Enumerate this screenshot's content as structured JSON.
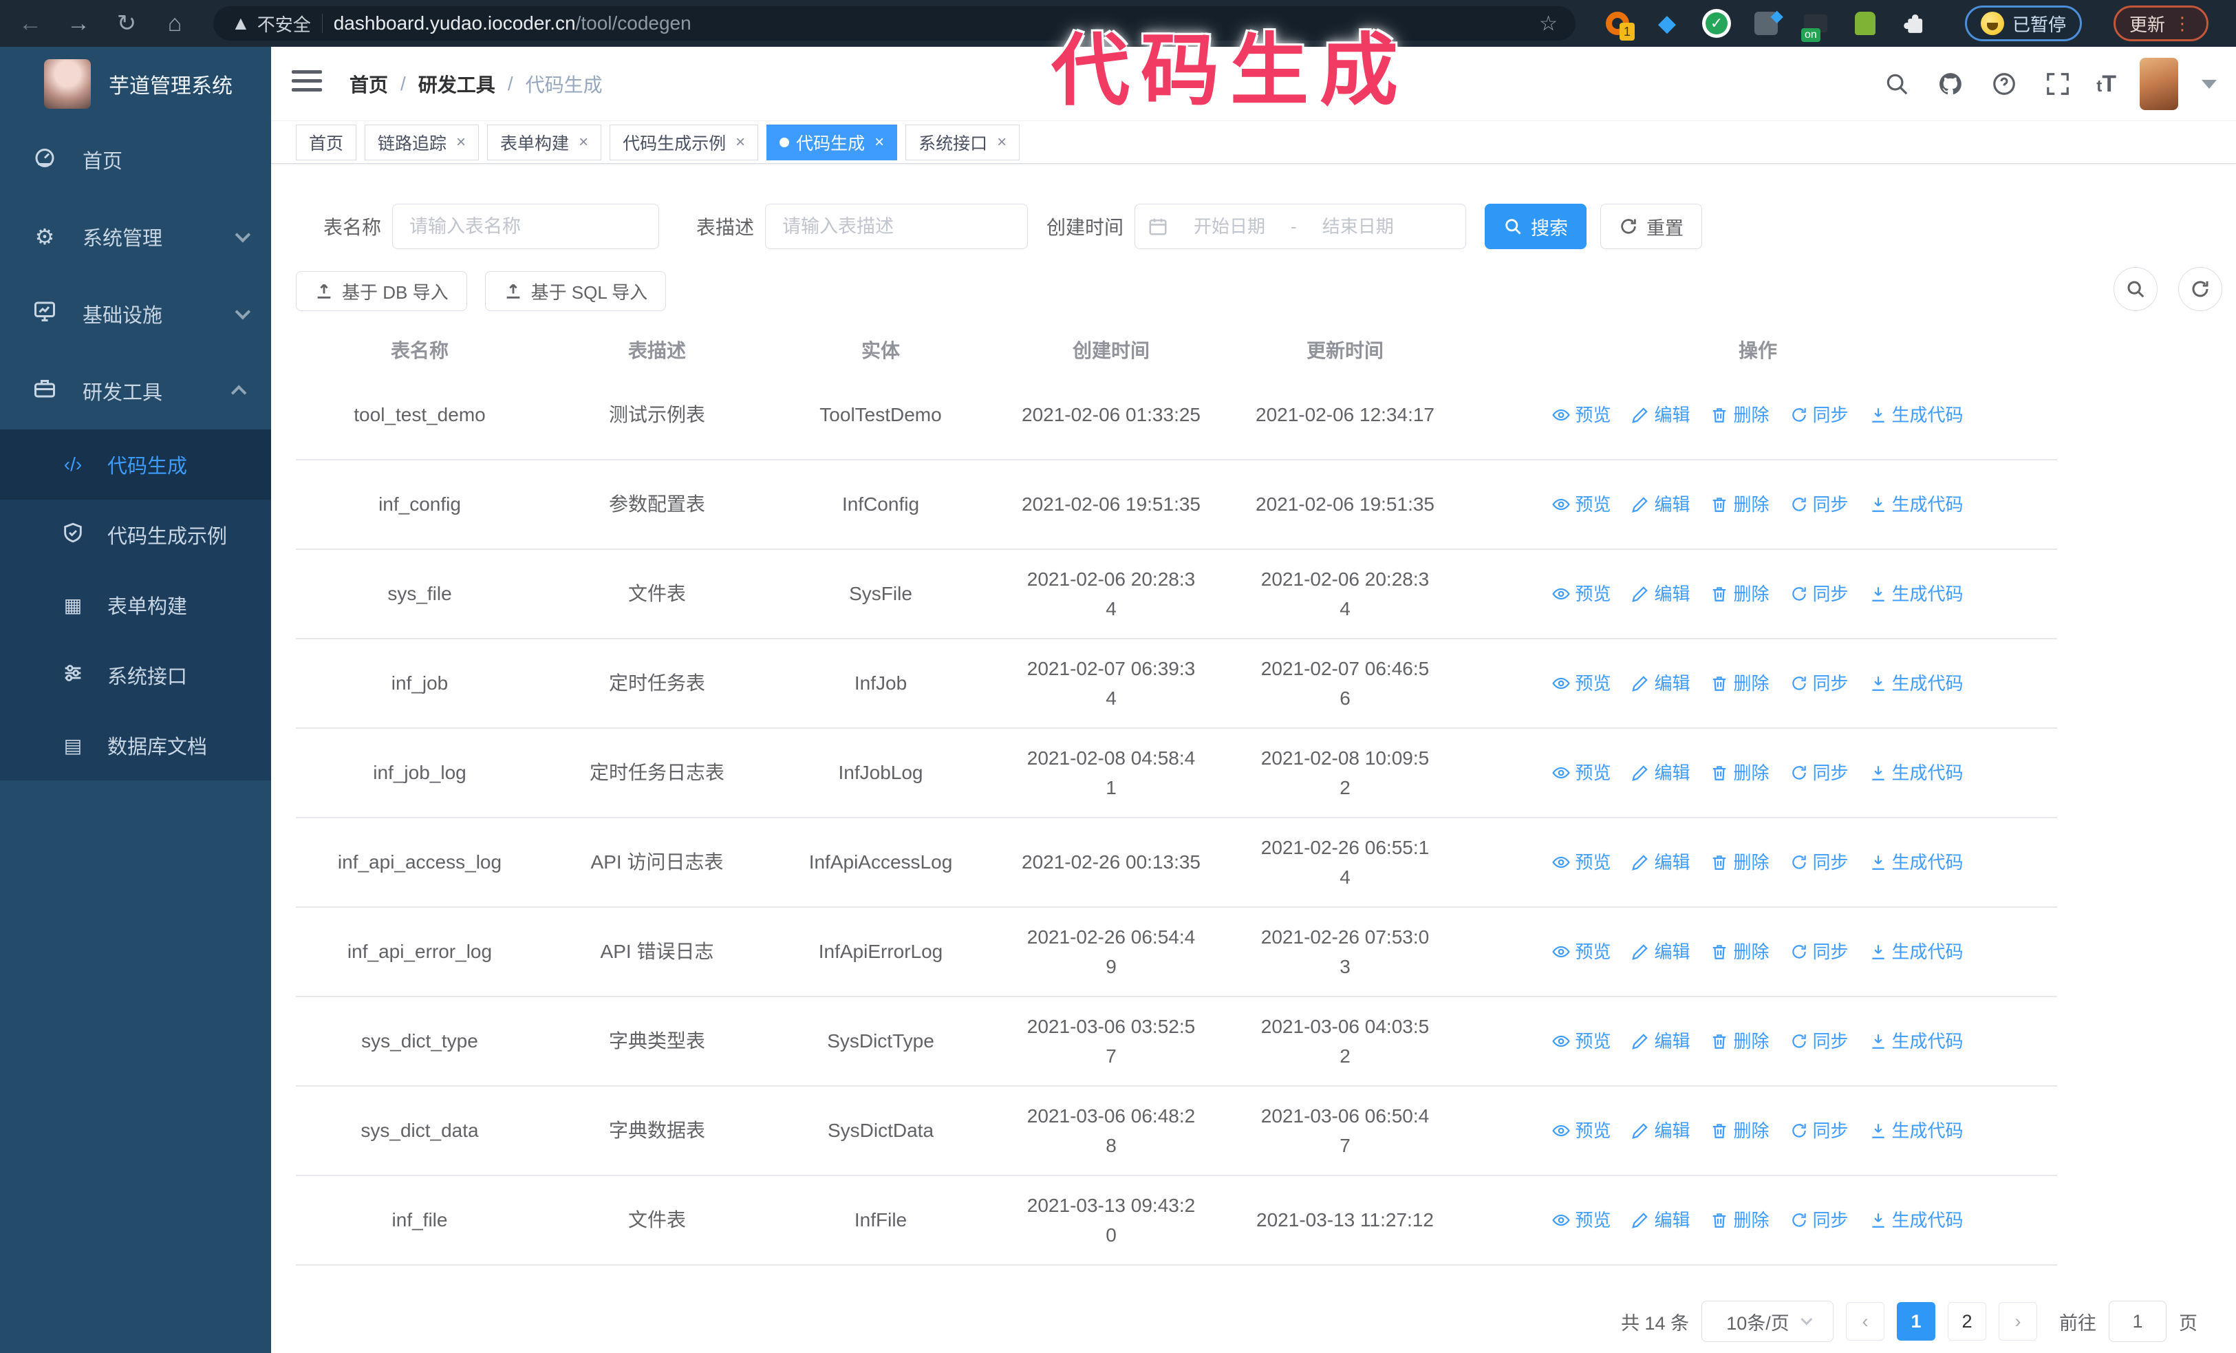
{
  "colors": {
    "accent_blue": "#3E9BFF",
    "button_blue": "#2F97F5",
    "overlay_pink": "#F23B63",
    "sidebar_bg": "#244B69",
    "submenu_bg": "#1C3D5C",
    "browser_bar_bg": "#1D2935"
  },
  "browser": {
    "security_label": "不安全",
    "url_host": "dashboard.yudao.iocoder.cn",
    "url_path": "/tool/codegen",
    "paused_badge": "已暂停",
    "update_badge": "更新",
    "extension_on_badge": "on",
    "extension_count_badge": "1"
  },
  "overlay_title": "代码生成",
  "logo": {
    "title": "芋道管理系统"
  },
  "breadcrumb": {
    "items": [
      "首页",
      "研发工具",
      "代码生成"
    ],
    "separator": "/"
  },
  "header_icons": [
    "search",
    "github",
    "help",
    "fullscreen",
    "font-size",
    "avatar",
    "caret-down"
  ],
  "tabs": [
    {
      "label": "首页",
      "closable": false,
      "active": false
    },
    {
      "label": "链路追踪",
      "closable": true,
      "active": false
    },
    {
      "label": "表单构建",
      "closable": true,
      "active": false
    },
    {
      "label": "代码生成示例",
      "closable": true,
      "active": false
    },
    {
      "label": "代码生成",
      "closable": true,
      "active": true
    },
    {
      "label": "系统接口",
      "closable": true,
      "active": false
    }
  ],
  "sidebar": {
    "items": [
      {
        "label": "首页",
        "icon": "dashboard",
        "chevron": "none",
        "active": false
      },
      {
        "label": "系统管理",
        "icon": "gear",
        "chevron": "down",
        "active": false
      },
      {
        "label": "基础设施",
        "icon": "monitor",
        "chevron": "down",
        "active": false
      },
      {
        "label": "研发工具",
        "icon": "toolbox",
        "chevron": "up",
        "active": false
      }
    ],
    "subitems": [
      {
        "label": "代码生成",
        "icon": "code",
        "active": true
      },
      {
        "label": "代码生成示例",
        "icon": "shield-check",
        "active": false
      },
      {
        "label": "表单构建",
        "icon": "form",
        "active": false
      },
      {
        "label": "系统接口",
        "icon": "sliders",
        "active": false
      },
      {
        "label": "数据库文档",
        "icon": "db-doc",
        "active": false
      }
    ]
  },
  "filters": {
    "name_label": "表名称",
    "name_placeholder": "请输入表名称",
    "desc_label": "表描述",
    "desc_placeholder": "请输入表描述",
    "time_label": "创建时间",
    "start_placeholder": "开始日期",
    "range_separator": "-",
    "end_placeholder": "结束日期",
    "search_label": "搜索",
    "reset_label": "重置"
  },
  "toolbar": {
    "import_db_label": "基于 DB 导入",
    "import_sql_label": "基于 SQL 导入"
  },
  "table": {
    "columns": [
      "表名称",
      "表描述",
      "实体",
      "创建时间",
      "更新时间",
      "操作"
    ],
    "actions": [
      "预览",
      "编辑",
      "删除",
      "同步",
      "生成代码"
    ],
    "rows": [
      {
        "name": "tool_test_demo",
        "desc": "测试示例表",
        "entity": "ToolTestDemo",
        "created": "2021-02-06 01:33:25",
        "updated": "2021-02-06 12:34:17"
      },
      {
        "name": "inf_config",
        "desc": "参数配置表",
        "entity": "InfConfig",
        "created": "2021-02-06 19:51:35",
        "updated": "2021-02-06 19:51:35"
      },
      {
        "name": "sys_file",
        "desc": "文件表",
        "entity": "SysFile",
        "created": "2021-02-06 20:28:3\n4",
        "updated": "2021-02-06 20:28:3\n4"
      },
      {
        "name": "inf_job",
        "desc": "定时任务表",
        "entity": "InfJob",
        "created": "2021-02-07 06:39:3\n4",
        "updated": "2021-02-07 06:46:5\n6"
      },
      {
        "name": "inf_job_log",
        "desc": "定时任务日志表",
        "entity": "InfJobLog",
        "created": "2021-02-08 04:58:4\n1",
        "updated": "2021-02-08 10:09:5\n2"
      },
      {
        "name": "inf_api_access_log",
        "desc": "API 访问日志表",
        "entity": "InfApiAccessLog",
        "created": "2021-02-26 00:13:35",
        "updated": "2021-02-26 06:55:1\n4"
      },
      {
        "name": "inf_api_error_log",
        "desc": "API 错误日志",
        "entity": "InfApiErrorLog",
        "created": "2021-02-26 06:54:4\n9",
        "updated": "2021-02-26 07:53:0\n3"
      },
      {
        "name": "sys_dict_type",
        "desc": "字典类型表",
        "entity": "SysDictType",
        "created": "2021-03-06 03:52:5\n7",
        "updated": "2021-03-06 04:03:5\n2"
      },
      {
        "name": "sys_dict_data",
        "desc": "字典数据表",
        "entity": "SysDictData",
        "created": "2021-03-06 06:48:2\n8",
        "updated": "2021-03-06 06:50:4\n7"
      },
      {
        "name": "inf_file",
        "desc": "文件表",
        "entity": "InfFile",
        "created": "2021-03-13 09:43:2\n0",
        "updated": "2021-03-13 11:27:12"
      }
    ]
  },
  "pagination": {
    "total_label": "共 14 条",
    "page_size_label": "10条/页",
    "pages": [
      "1",
      "2"
    ],
    "active_page": "1",
    "goto_label": "前往",
    "goto_value": "1",
    "page_suffix": "页"
  }
}
